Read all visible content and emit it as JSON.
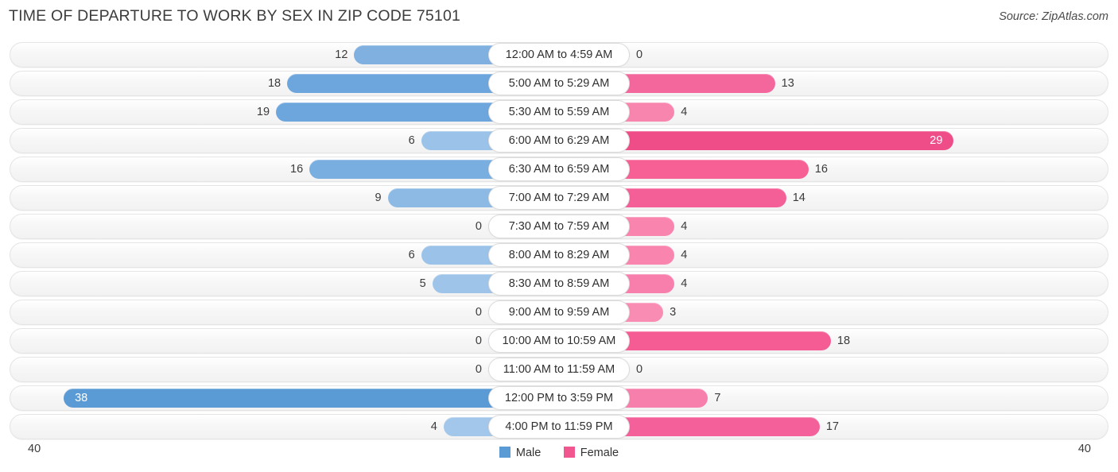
{
  "header": {
    "title": "TIME OF DEPARTURE TO WORK BY SEX IN ZIP CODE 75101",
    "source": "Source: ZipAtlas.com"
  },
  "legend": {
    "male_label": "Male",
    "female_label": "Female",
    "male_color": "#5b9bd5",
    "female_color": "#f2568f"
  },
  "axis": {
    "left_label": "40",
    "right_label": "40"
  },
  "chart_data": {
    "type": "bar",
    "subtype": "diverging-bidirectional-bar",
    "title": "TIME OF DEPARTURE TO WORK BY SEX IN ZIP CODE 75101",
    "xlabel": "",
    "ylabel": "",
    "xlim": [
      -40,
      40
    ],
    "axis_max": 40,
    "grid": false,
    "legend_position": "bottom-center",
    "categories": [
      "12:00 AM to 4:59 AM",
      "5:00 AM to 5:29 AM",
      "5:30 AM to 5:59 AM",
      "6:00 AM to 6:29 AM",
      "6:30 AM to 6:59 AM",
      "7:00 AM to 7:29 AM",
      "7:30 AM to 7:59 AM",
      "8:00 AM to 8:29 AM",
      "8:30 AM to 8:59 AM",
      "9:00 AM to 9:59 AM",
      "10:00 AM to 10:59 AM",
      "11:00 AM to 11:59 AM",
      "12:00 PM to 3:59 PM",
      "4:00 PM to 11:59 PM"
    ],
    "series": [
      {
        "name": "Male",
        "color": "#5b9bd5",
        "values": [
          12,
          18,
          19,
          6,
          16,
          9,
          0,
          6,
          5,
          0,
          0,
          0,
          38,
          4
        ]
      },
      {
        "name": "Female",
        "color": "#f2568f",
        "values": [
          0,
          13,
          4,
          29,
          16,
          14,
          4,
          4,
          4,
          3,
          18,
          0,
          7,
          17
        ]
      }
    ]
  },
  "rows": [
    {
      "label": "12:00 AM to 4:59 AM",
      "male": 12,
      "female": 0,
      "male_color": "#7fb0e0",
      "female_color": "#f993b8",
      "male_inside": false,
      "female_inside": false
    },
    {
      "label": "5:00 AM to 5:29 AM",
      "male": 18,
      "female": 13,
      "male_color": "#6da5dd",
      "female_color": "#f3679d",
      "male_inside": false,
      "female_inside": false
    },
    {
      "label": "5:30 AM to 5:59 AM",
      "male": 19,
      "female": 4,
      "male_color": "#6da5dd",
      "female_color": "#f885ae",
      "male_inside": false,
      "female_inside": false
    },
    {
      "label": "6:00 AM to 6:29 AM",
      "male": 6,
      "female": 29,
      "male_color": "#9bc2e8",
      "female_color": "#ee4d87",
      "male_inside": false,
      "female_inside": true
    },
    {
      "label": "6:30 AM to 6:59 AM",
      "male": 16,
      "female": 16,
      "male_color": "#78aee0",
      "female_color": "#f66094",
      "male_inside": false,
      "female_inside": false
    },
    {
      "label": "7:00 AM to 7:29 AM",
      "male": 9,
      "female": 14,
      "male_color": "#8dbae5",
      "female_color": "#f45f97",
      "male_inside": false,
      "female_inside": false
    },
    {
      "label": "7:30 AM to 7:59 AM",
      "male": 0,
      "female": 4,
      "male_color": "#a3c7ea",
      "female_color": "#f985ae",
      "male_inside": false,
      "female_inside": false
    },
    {
      "label": "8:00 AM to 8:29 AM",
      "male": 6,
      "female": 4,
      "male_color": "#9bc2e8",
      "female_color": "#f985ae",
      "male_inside": false,
      "female_inside": false
    },
    {
      "label": "8:30 AM to 8:59 AM",
      "male": 5,
      "female": 4,
      "male_color": "#9ec4e9",
      "female_color": "#f87fac",
      "male_inside": false,
      "female_inside": false
    },
    {
      "label": "9:00 AM to 9:59 AM",
      "male": 0,
      "female": 3,
      "male_color": "#a3c7ea",
      "female_color": "#f98cb3",
      "male_inside": false,
      "female_inside": false
    },
    {
      "label": "10:00 AM to 10:59 AM",
      "male": 0,
      "female": 18,
      "male_color": "#a3c7ea",
      "female_color": "#f45c93",
      "male_inside": false,
      "female_inside": false
    },
    {
      "label": "11:00 AM to 11:59 AM",
      "male": 0,
      "female": 0,
      "male_color": "#a3c7ea",
      "female_color": "#f99cc0",
      "male_inside": false,
      "female_inside": false
    },
    {
      "label": "12:00 PM to 3:59 PM",
      "male": 38,
      "female": 7,
      "male_color": "#5b9bd5",
      "female_color": "#f77fab",
      "male_inside": true,
      "female_inside": false
    },
    {
      "label": "4:00 PM to 11:59 PM",
      "male": 4,
      "female": 17,
      "male_color": "#a3c7ea",
      "female_color": "#f4619a",
      "male_inside": false,
      "female_inside": false
    }
  ]
}
